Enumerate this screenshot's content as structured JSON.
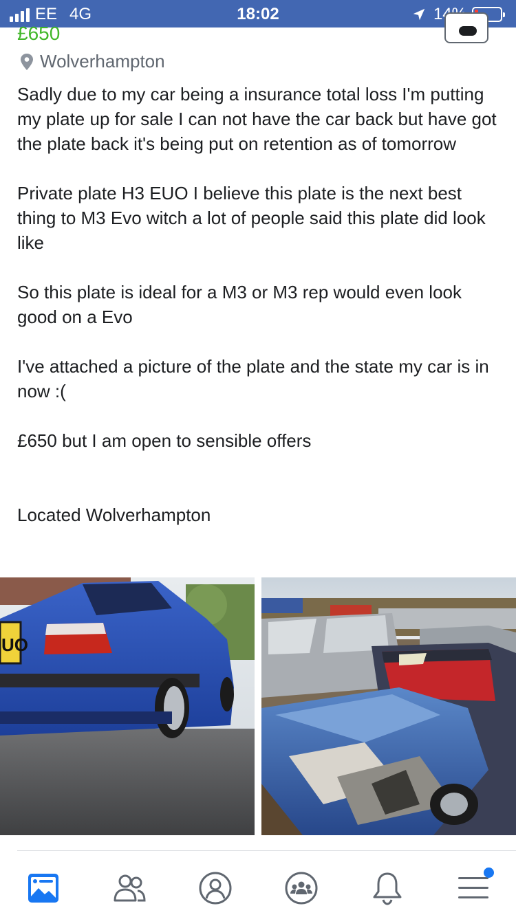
{
  "status_bar": {
    "carrier": "EE",
    "network": "4G",
    "time": "18:02",
    "battery": "14%",
    "battery_level": 0.14,
    "signal_bars": 4
  },
  "listing": {
    "price": "£650",
    "location": "Wolverhampton",
    "description": "Sadly due to my car being a insurance total loss I'm putting my plate up for sale I can not have the car back but have got the plate back it's being put on retention as of tomorrow\n\nPrivate plate H3 EUO I believe this plate is the next best thing to M3 Evo witch a lot of people said this plate did look like\n\nSo this plate is ideal for a M3 or M3 rep would even look good on a Evo\n\nI've attached a picture of the plate and the state my car is in now :(\n\n£650 but I am open to sensible offers\n\n\nLocated Wolverhampton",
    "photos": [
      {
        "label": "photo-blue-car-rear-plate"
      },
      {
        "label": "photo-crashed-car"
      }
    ],
    "plate_fragment": "UO"
  },
  "icons": {
    "message": "message-icon",
    "location": "location-pin-icon",
    "tabs": [
      "news-feed-icon",
      "friends-icon",
      "profile-icon",
      "groups-icon",
      "notifications-icon",
      "menu-icon"
    ]
  },
  "colors": {
    "status_bar": "#4267b2",
    "price": "#42b72a",
    "active_tab": "#1877f2",
    "inactive_tab": "#606770"
  }
}
